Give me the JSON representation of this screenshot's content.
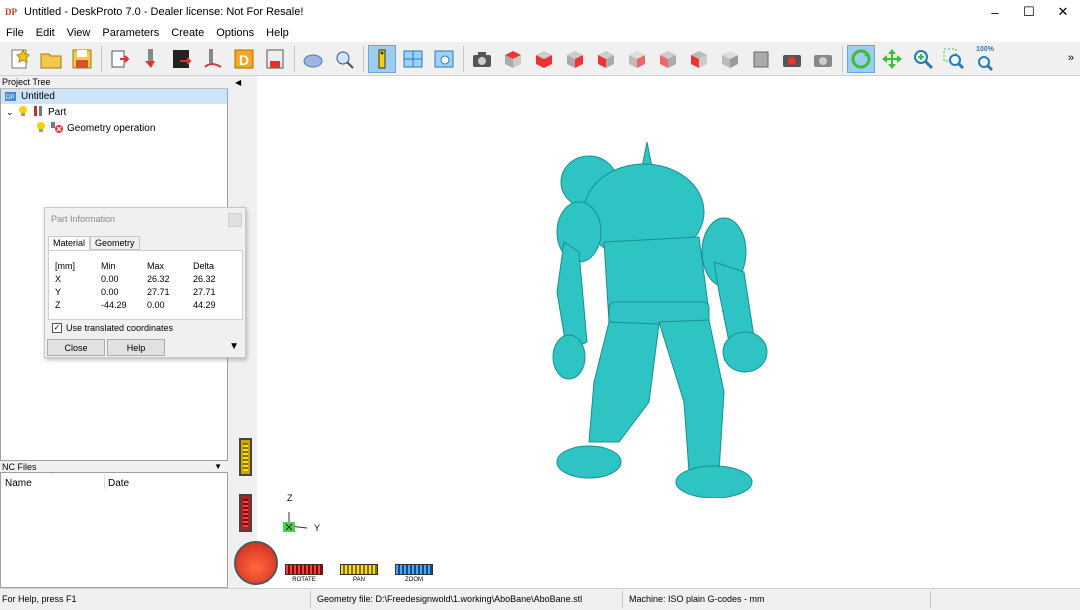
{
  "window": {
    "title": "Untitled - DeskProto 7.0 - Dealer license: Not For Resale!",
    "controls": [
      "–",
      "☐",
      "✕"
    ]
  },
  "menu": [
    "File",
    "Edit",
    "View",
    "Parameters",
    "Create",
    "Options",
    "Help"
  ],
  "toolbar": {
    "zoom_100_label": "100%",
    "more_label": "»"
  },
  "project_tree": {
    "header": "Project Tree",
    "items": [
      {
        "label": "Untitled"
      },
      {
        "label": "Part"
      },
      {
        "label": "Geometry operation"
      }
    ]
  },
  "nc_files": {
    "header": "NC Files",
    "columns": [
      "Name",
      "Date"
    ]
  },
  "part_info": {
    "title": "Part Information",
    "tabs": [
      "Material",
      "Geometry"
    ],
    "headers": [
      "[mm]",
      "Min",
      "Max",
      "Delta"
    ],
    "rows": [
      [
        "X",
        "0.00",
        "26.32",
        "26.32"
      ],
      [
        "Y",
        "0.00",
        "27.71",
        "27.71"
      ],
      [
        "Z",
        "-44.29",
        "0.00",
        "44.29"
      ]
    ],
    "checkbox_label": "Use translated coordinates",
    "checkbox_checked": true,
    "close_label": "Close",
    "help_label": "Help"
  },
  "viewport": {
    "model_color": "#2ec4c4",
    "axis_z": "Z",
    "axis_y": "Y",
    "controls": [
      "ROTATE",
      "PAN",
      "ZOOM"
    ]
  },
  "status": {
    "help": "For Help, press F1",
    "geometry_file": "Geometry file: D:\\Freedesignwold\\1.working\\AboBane\\AboBane.stl",
    "machine": "Machine: ISO plain G-codes - mm"
  }
}
